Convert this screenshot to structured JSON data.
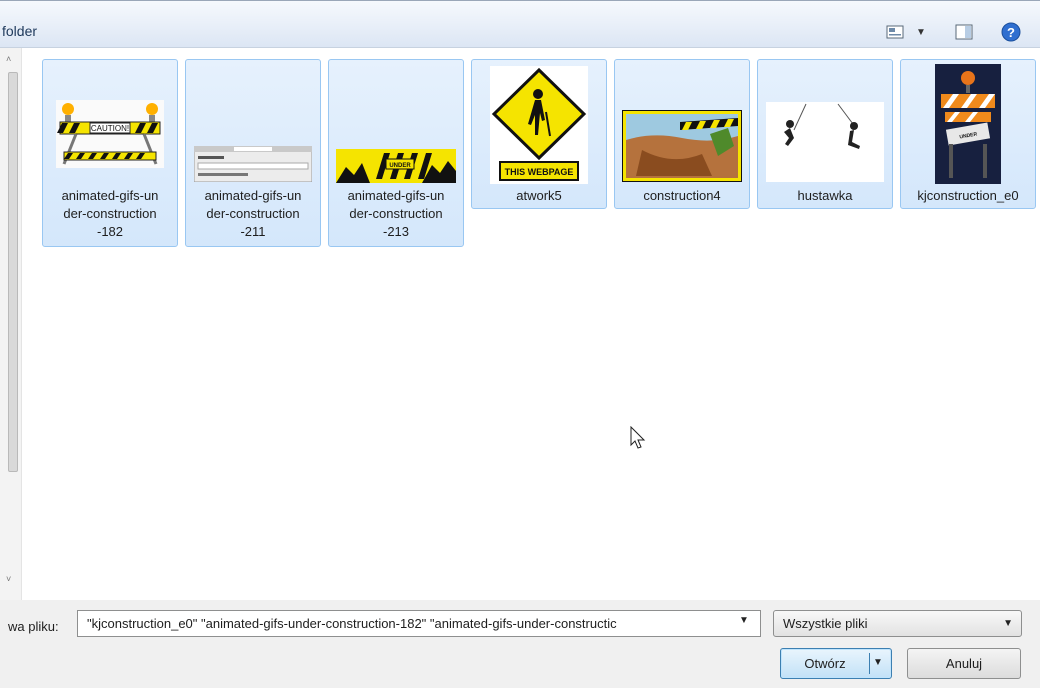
{
  "toolbar": {
    "title": "folder",
    "views_icon": "views-icon",
    "views_menu_icon": "chevron-down-icon",
    "preview_icon": "preview-pane-icon",
    "help_icon": "help-icon"
  },
  "files": [
    {
      "name": "animated-gifs-under-construction-182",
      "label_lines": [
        "animated-gifs-un",
        "der-construction",
        "-182"
      ],
      "thumb": "caution-barrier-icon"
    },
    {
      "name": "animated-gifs-under-construction-211",
      "label_lines": [
        "animated-gifs-un",
        "der-construction",
        "-211"
      ],
      "thumb": "dialog-screenshot-icon"
    },
    {
      "name": "animated-gifs-under-construction-213",
      "label_lines": [
        "animated-gifs-un",
        "der-construction",
        "-213"
      ],
      "thumb": "construction-banner-icon"
    },
    {
      "name": "atwork5",
      "label_lines": [
        "atwork5"
      ],
      "thumb": "men-at-work-sign-icon"
    },
    {
      "name": "construction4",
      "label_lines": [
        "construction4"
      ],
      "thumb": "construction-site-icon"
    },
    {
      "name": "hustawka",
      "label_lines": [
        "hustawka"
      ],
      "thumb": "swing-figures-icon"
    },
    {
      "name": "kjconstruction_e0",
      "label_lines": [
        "kjconstruction_e0"
      ],
      "thumb": "construction-barricade-icon"
    }
  ],
  "bottom": {
    "filename_label": "wa pliku:",
    "filename_value": "\"kjconstruction_e0\" \"animated-gifs-under-construction-182\" \"animated-gifs-under-constructic",
    "filetype_value": "Wszystkie pliki",
    "open_label": "Otwórz",
    "cancel_label": "Anuluj"
  },
  "colors": {
    "selection_fill": "#dbeafc",
    "selection_border": "#99c7f2",
    "toolbar_bg": "#e3ebf6",
    "caution_yellow": "#f5e400",
    "open_button_border": "#3c7fb1"
  }
}
